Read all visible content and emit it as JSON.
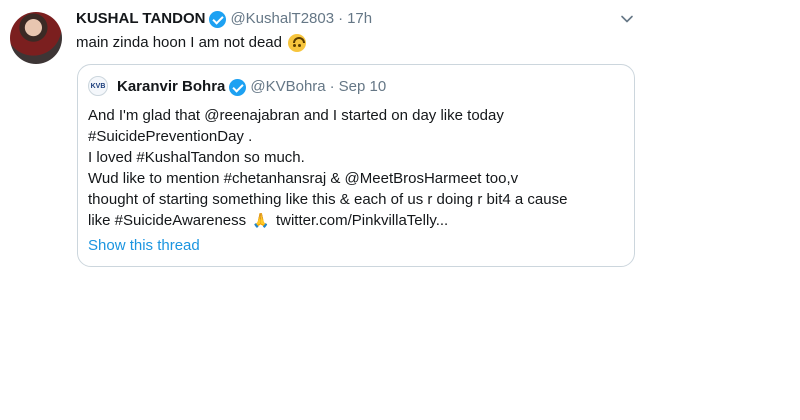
{
  "tweet": {
    "author_name": "KUSHAL TANDON",
    "author_handle": "@KushalT2803",
    "separator": "·",
    "time": "17h",
    "text": "main zinda hoon I am not dead",
    "emoji_icon": "upside-down-face-icon"
  },
  "quoted_tweet": {
    "author_name": "Karanvir Bohra",
    "author_handle": "@KVBohra",
    "separator": "·",
    "date": "Sep 10",
    "avatar_text": "KVB",
    "lines": [
      "And I'm glad that @reenajabran and I started on day like today",
      "#SuicidePreventionDay .",
      "I loved #KushalTandon so much.",
      "Wud like to mention #chetanhansraj & @MeetBrosHarmeet too,v",
      "thought of starting something like this & each of us r doing r bit4 a cause",
      "like #SuicideAwareness",
      "twitter.com/PinkvillaTelly..."
    ],
    "pray_emoji": "🙏",
    "show_thread_label": "Show this thread"
  },
  "colors": {
    "verified": "#1da1f2",
    "link": "#1b95e0",
    "secondary_text": "#657786",
    "border": "#ccd6dd"
  }
}
